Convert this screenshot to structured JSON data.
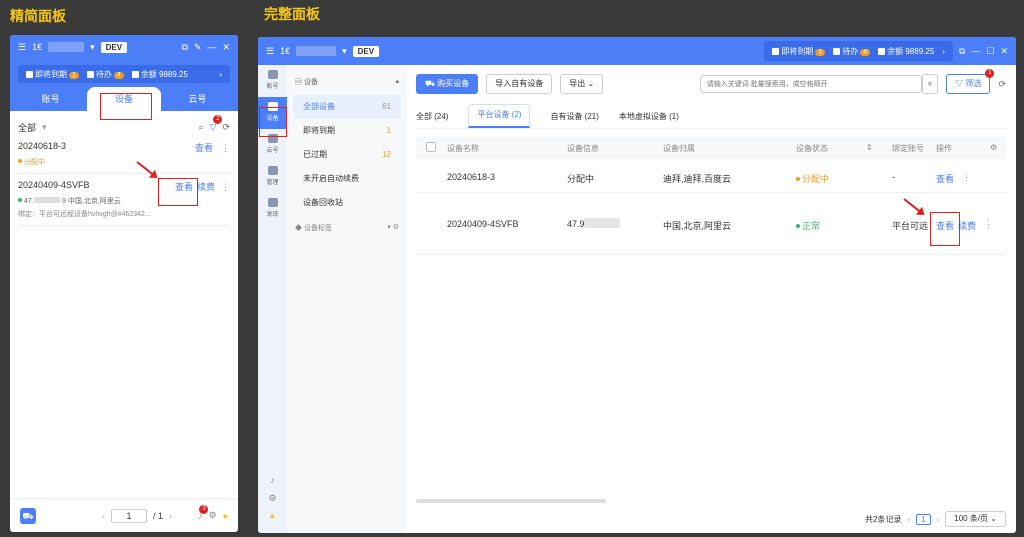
{
  "labels": {
    "simple": "精简面板",
    "full": "完整面板"
  },
  "app": {
    "account_prefix": "1€",
    "account_prefix_full": "1€",
    "dev": "DEV"
  },
  "stats": {
    "expiring": "即将到期",
    "expiring_count": "1",
    "pending": "待办",
    "pending_count": "4",
    "balance": "余额 9889.25"
  },
  "simple": {
    "tabs": [
      "账号",
      "设备",
      "云号"
    ],
    "filter_label": "全部",
    "filter_badge": "2",
    "rows": [
      {
        "name": "20240618-3",
        "status": "分配中",
        "view": "查看"
      },
      {
        "name": "20240409-4SVFB",
        "ip_prefix": "47.",
        "detail": "·9 中国,北京,阿里云",
        "bind": "绑定：平台可远程设备hvhvgh@#462342...",
        "view": "查看",
        "renew": "续费"
      }
    ],
    "page_current": "1",
    "page_total": "/ 1",
    "bell_badge": "3"
  },
  "full": {
    "sidebar": [
      {
        "label": "账号",
        "icon": "user-icon"
      },
      {
        "label": "设备",
        "icon": "device-icon"
      },
      {
        "label": "云号",
        "icon": "cloud-icon"
      },
      {
        "label": "管理",
        "icon": "manage-icon"
      },
      {
        "label": "发现",
        "icon": "discover-icon"
      }
    ],
    "cat_header": "设备",
    "cats": [
      {
        "name": "全部设备",
        "count": "61"
      },
      {
        "name": "即将到期",
        "count": "1"
      },
      {
        "name": "已过期",
        "count": "12"
      },
      {
        "name": "未开启自动续费",
        "count": ""
      },
      {
        "name": "设备回收站",
        "count": ""
      }
    ],
    "cat_tags": "设备标签",
    "buttons": {
      "buy": "购买设备",
      "import": "导入自有设备",
      "export": "导出"
    },
    "search_placeholder": "请输入关键词 批量搜索用，或空格隔开",
    "filter": "筛选",
    "filter_badge": "1",
    "tabs": [
      "全部 (24)",
      "平台设备 (2)",
      "自有设备 (21)",
      "本地虚拟设备 (1)"
    ],
    "columns": [
      "设备名称",
      "设备信息",
      "设备归属",
      "设备状态",
      "绑定账号",
      "操作"
    ],
    "rows": [
      {
        "name": "20240618-3",
        "info": "分配中",
        "owner": "迪拜,迪拜,百度云",
        "status": "分配中",
        "bind": "-",
        "view": "查看"
      },
      {
        "name": "20240409-4SVFB",
        "info": "47.9",
        "owner": "中国,北京,阿里云",
        "status": "正常",
        "bind": "平台可远",
        "view": "查看",
        "renew": "续费"
      }
    ],
    "footer_total": "共2条记录",
    "page": "1",
    "page_size": "100 条/页"
  }
}
